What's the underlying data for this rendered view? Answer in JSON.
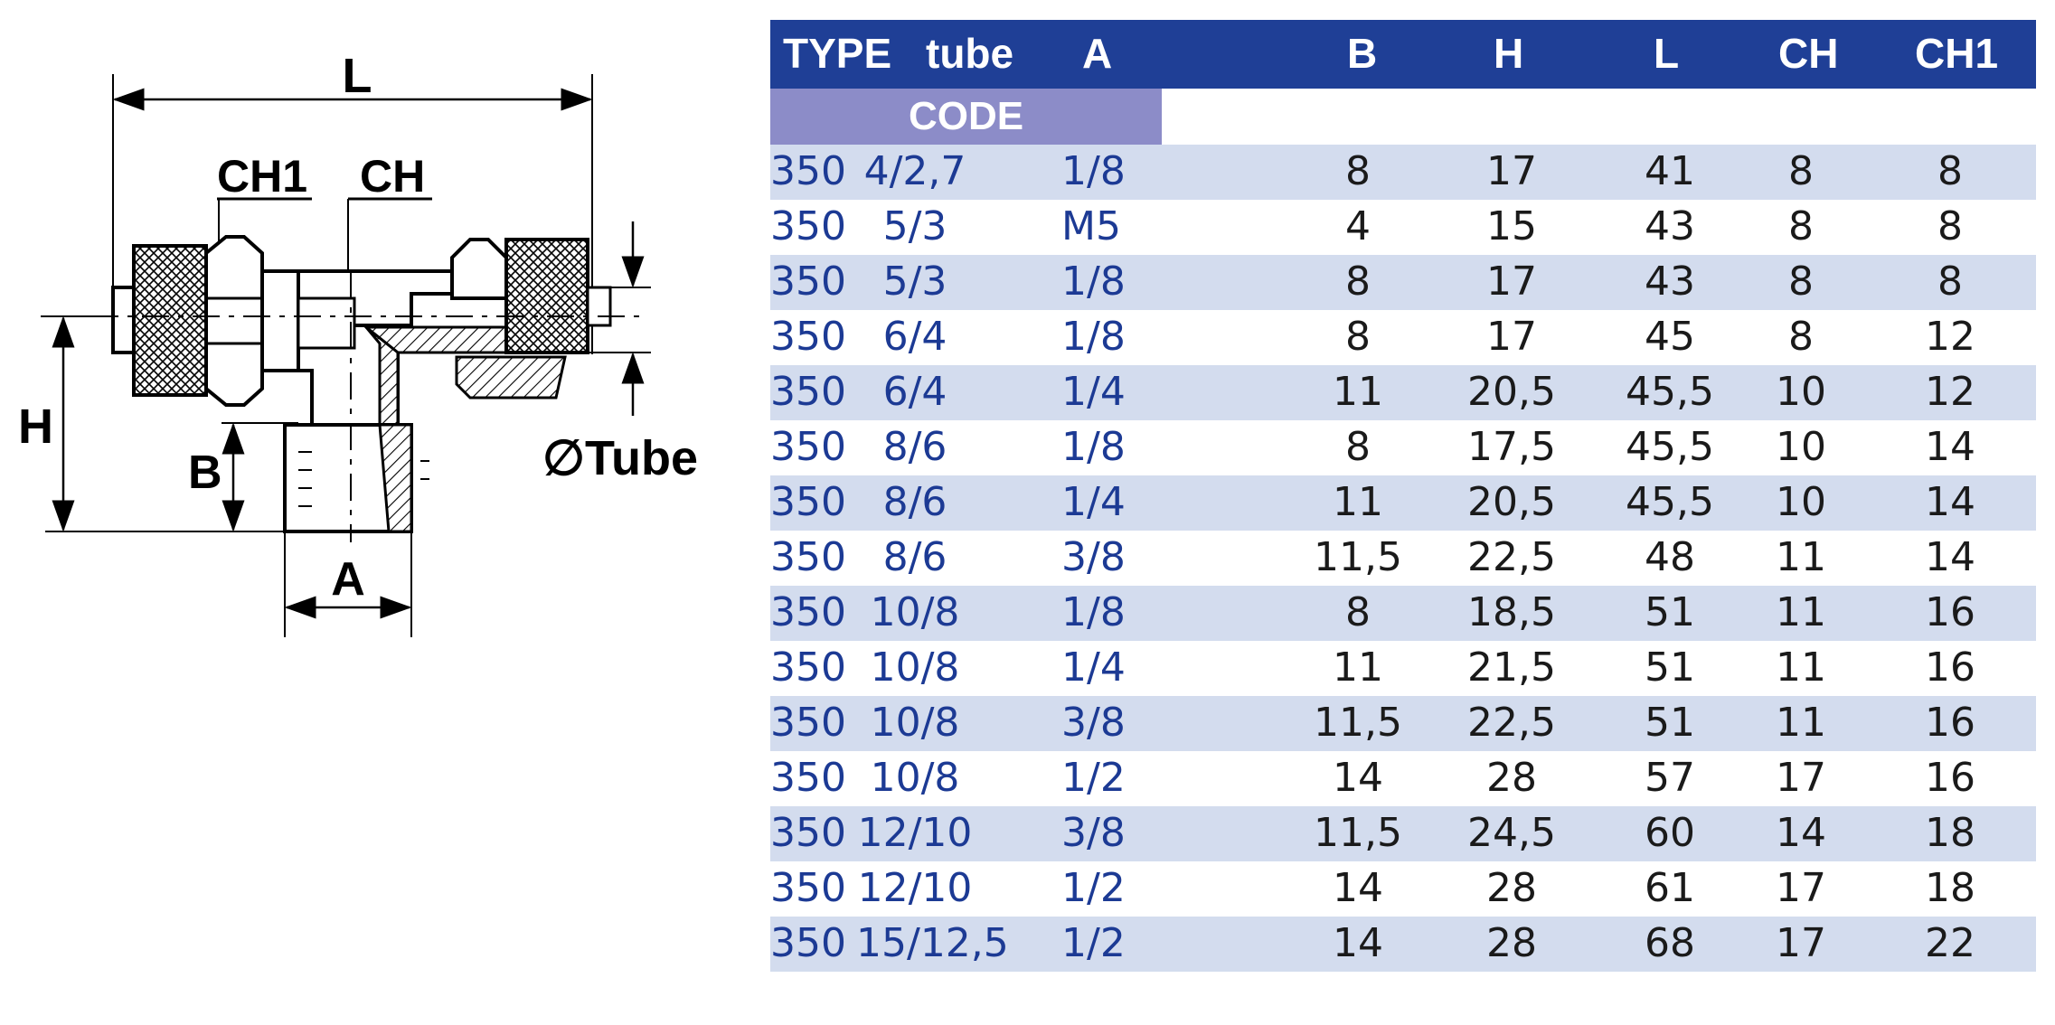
{
  "drawing": {
    "labels": {
      "L": "L",
      "CH1": "CH1",
      "CH": "CH",
      "H": "H",
      "B": "B",
      "A": "A",
      "tube": "∅Tube"
    }
  },
  "table": {
    "headers": [
      "TYPE",
      "tube",
      "A",
      "B",
      "H",
      "L",
      "CH",
      "CH1"
    ],
    "code_label": "CODE",
    "rows": [
      [
        "350",
        "4/2,7",
        "1/8",
        "8",
        "17",
        "41",
        "8",
        "8"
      ],
      [
        "350",
        "5/3",
        "M5",
        "4",
        "15",
        "43",
        "8",
        "8"
      ],
      [
        "350",
        "5/3",
        "1/8",
        "8",
        "17",
        "43",
        "8",
        "8"
      ],
      [
        "350",
        "6/4",
        "1/8",
        "8",
        "17",
        "45",
        "8",
        "12"
      ],
      [
        "350",
        "6/4",
        "1/4",
        "11",
        "20,5",
        "45,5",
        "10",
        "12"
      ],
      [
        "350",
        "8/6",
        "1/8",
        "8",
        "17,5",
        "45,5",
        "10",
        "14"
      ],
      [
        "350",
        "8/6",
        "1/4",
        "11",
        "20,5",
        "45,5",
        "10",
        "14"
      ],
      [
        "350",
        "8/6",
        "3/8",
        "11,5",
        "22,5",
        "48",
        "11",
        "14"
      ],
      [
        "350",
        "10/8",
        "1/8",
        "8",
        "18,5",
        "51",
        "11",
        "16"
      ],
      [
        "350",
        "10/8",
        "1/4",
        "11",
        "21,5",
        "51",
        "11",
        "16"
      ],
      [
        "350",
        "10/8",
        "3/8",
        "11,5",
        "22,5",
        "51",
        "11",
        "16"
      ],
      [
        "350",
        "10/8",
        "1/2",
        "14",
        "28",
        "57",
        "17",
        "16"
      ],
      [
        "350",
        "12/10",
        "3/8",
        "11,5",
        "24,5",
        "60",
        "14",
        "18"
      ],
      [
        "350",
        "12/10",
        "1/2",
        "14",
        "28",
        "61",
        "17",
        "18"
      ],
      [
        "350",
        "15/12,5",
        "1/2",
        "14",
        "28",
        "68",
        "17",
        "22"
      ]
    ]
  },
  "colors": {
    "header_bg": "#1f3f96",
    "code_bg": "#8c8cc8",
    "row_alt_bg": "#d3dcee",
    "code_text": "#1c3a94",
    "dim_text": "#1a1a1a"
  }
}
